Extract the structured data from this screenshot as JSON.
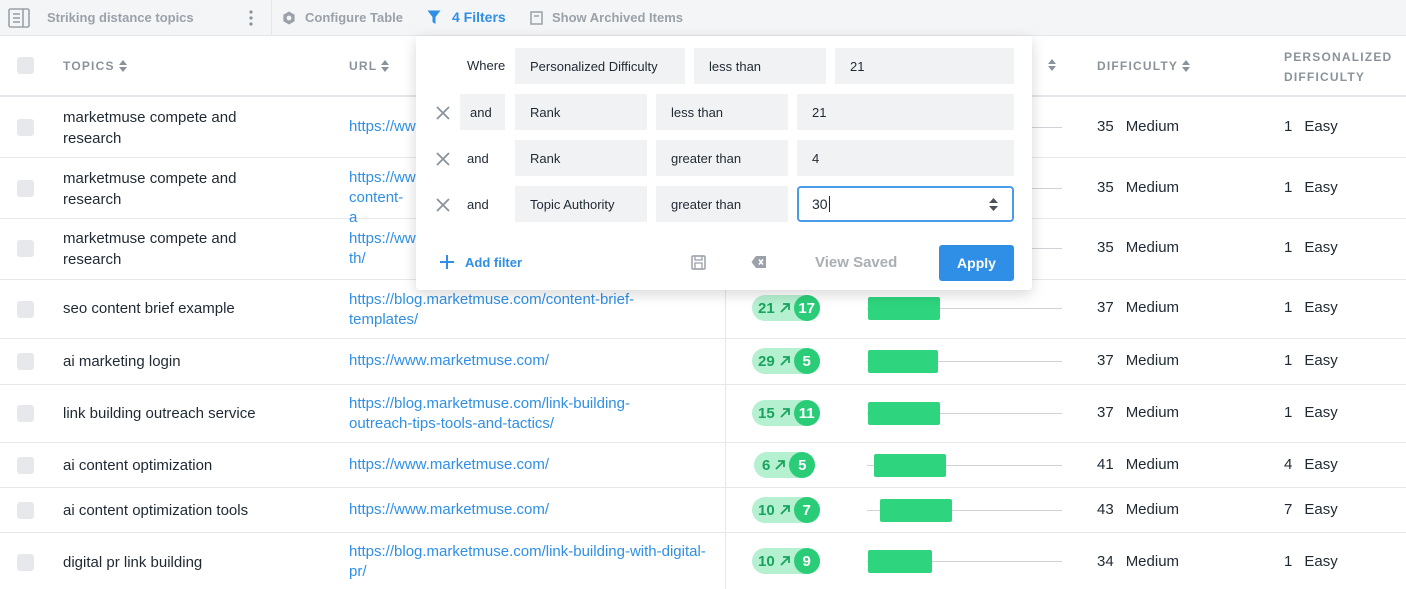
{
  "toolbar": {
    "title": "Striking distance topics",
    "configure_label": "Configure Table",
    "filters_label": "4 Filters",
    "archived_label": "Show Archived Items"
  },
  "headers": {
    "topics": "TOPICS",
    "url": "URL",
    "difficulty": "DIFFICULTY",
    "personalized_line1": "PERSONALIZED",
    "personalized_line2": "DIFFICULTY"
  },
  "rows": [
    {
      "topic": "marketmuse compete and research",
      "url": "https://ww",
      "rank": "",
      "trend": "",
      "bar": 0,
      "difficulty": "35",
      "difficulty_label": "Medium",
      "pdifficulty": "1",
      "pdifficulty_label": "Easy"
    },
    {
      "topic": "marketmuse compete and research",
      "url": "https://ww content-a",
      "rank": "",
      "trend": "",
      "bar": 0,
      "difficulty": "35",
      "difficulty_label": "Medium",
      "pdifficulty": "1",
      "pdifficulty_label": "Easy"
    },
    {
      "topic": "marketmuse compete and research",
      "url": "https://ww th/",
      "rank": "",
      "trend": "",
      "bar": 0,
      "difficulty": "35",
      "difficulty_label": "Medium",
      "pdifficulty": "1",
      "pdifficulty_label": "Easy"
    },
    {
      "topic": "seo content brief example",
      "url": "https://blog.marketmuse.com/content-brief-templates/",
      "rank": "21",
      "trend": "17",
      "bar": 0.37,
      "difficulty": "37",
      "difficulty_label": "Medium",
      "pdifficulty": "1",
      "pdifficulty_label": "Easy"
    },
    {
      "topic": "ai marketing login",
      "url": "https://www.marketmuse.com/",
      "rank": "29",
      "trend": "5",
      "bar": 0.36,
      "difficulty": "37",
      "difficulty_label": "Medium",
      "pdifficulty": "1",
      "pdifficulty_label": "Easy"
    },
    {
      "topic": "link building outreach service",
      "url": "https://blog.marketmuse.com/link-building-outreach-tips-tools-and-tactics/",
      "rank": "15",
      "trend": "11",
      "bar": 0.37,
      "difficulty": "37",
      "difficulty_label": "Medium",
      "pdifficulty": "1",
      "pdifficulty_label": "Easy"
    },
    {
      "topic": "ai content optimization",
      "url": "https://www.marketmuse.com/",
      "rank": "6",
      "trend": "5",
      "bar": 0.37,
      "difficulty": "41",
      "difficulty_label": "Medium",
      "pdifficulty": "4",
      "pdifficulty_label": "Easy"
    },
    {
      "topic": "ai content optimization tools",
      "url": "https://www.marketmuse.com/",
      "rank": "10",
      "trend": "7",
      "bar": 0.37,
      "difficulty": "43",
      "difficulty_label": "Medium",
      "pdifficulty": "7",
      "pdifficulty_label": "Easy"
    },
    {
      "topic": "digital pr link building",
      "url": "https://blog.marketmuse.com/link-building-with-digital-pr/",
      "rank": "10",
      "trend": "9",
      "bar": 0.33,
      "difficulty": "34",
      "difficulty_label": "Medium",
      "pdifficulty": "1",
      "pdifficulty_label": "Easy"
    }
  ],
  "filters": {
    "where_label": "Where",
    "rows": [
      {
        "conj": "",
        "field": "Personalized Difficulty",
        "op": "less than",
        "value": "21"
      },
      {
        "conj": "and",
        "field": "Rank",
        "op": "less than",
        "value": "21"
      },
      {
        "conj": "and",
        "field": "Rank",
        "op": "greater than",
        "value": "4"
      },
      {
        "conj": "and",
        "field": "Topic Authority",
        "op": "greater than",
        "value": "30"
      }
    ],
    "add_filter": "Add filter",
    "view_saved": "View Saved",
    "apply": "Apply"
  },
  "colors": {
    "accent": "#2f8fe6",
    "pill_light": "#b5f0d0",
    "pill_dark": "#2bcc77",
    "bar": "#2ed47e"
  }
}
